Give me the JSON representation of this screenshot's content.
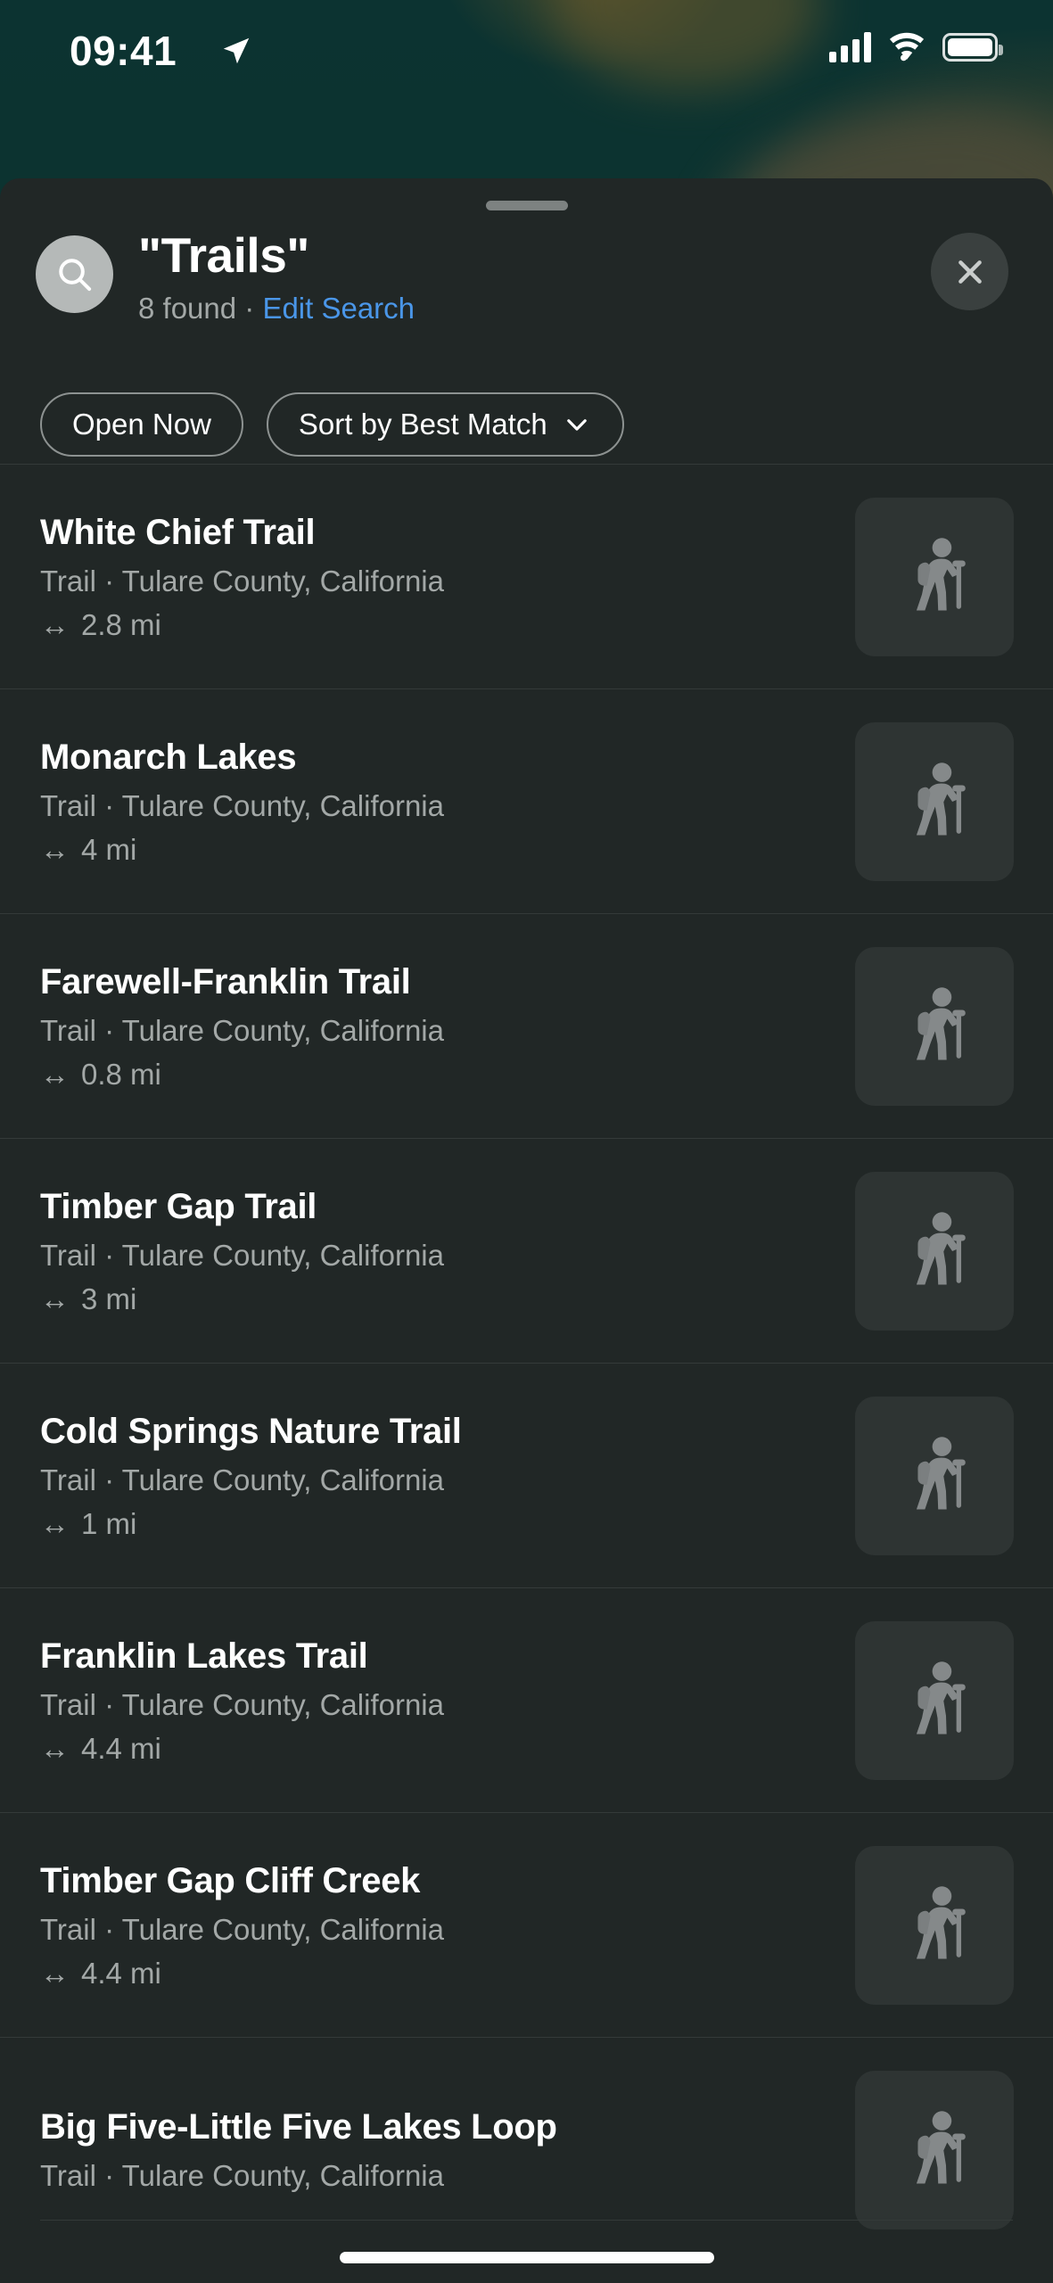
{
  "status_bar": {
    "time": "09:41",
    "location_icon": "location-arrow-icon",
    "cellular_icon": "cellular-signal-icon",
    "wifi_icon": "wifi-icon",
    "battery_icon": "battery-full-icon"
  },
  "map": {
    "background_color": "#0c3331",
    "terrain_color": "#4a4a38"
  },
  "sheet": {
    "search_icon": "search-icon",
    "title": "\"Trails\"",
    "found_count": "8 found",
    "separator": " · ",
    "edit_search": "Edit Search",
    "close_icon": "close-icon",
    "accent_color": "#4a96e8"
  },
  "filters": [
    {
      "label": "Open Now",
      "has_chevron": false
    },
    {
      "label": "Sort by Best Match",
      "has_chevron": true,
      "chevron_icon": "chevron-down-icon"
    }
  ],
  "results": [
    {
      "title": "White Chief Trail",
      "subtitle": "Trail · Tulare County, California",
      "distance": "2.8 mi",
      "thumb_icon": "hiker-icon"
    },
    {
      "title": "Monarch Lakes",
      "subtitle": "Trail · Tulare County, California",
      "distance": "4 mi",
      "thumb_icon": "hiker-icon"
    },
    {
      "title": "Farewell-Franklin Trail",
      "subtitle": "Trail · Tulare County, California",
      "distance": "0.8 mi",
      "thumb_icon": "hiker-icon"
    },
    {
      "title": "Timber Gap Trail",
      "subtitle": "Trail · Tulare County, California",
      "distance": "3 mi",
      "thumb_icon": "hiker-icon"
    },
    {
      "title": "Cold Springs Nature Trail",
      "subtitle": "Trail · Tulare County, California",
      "distance": "1 mi",
      "thumb_icon": "hiker-icon"
    },
    {
      "title": "Franklin Lakes Trail",
      "subtitle": "Trail · Tulare County, California",
      "distance": "4.4 mi",
      "thumb_icon": "hiker-icon"
    },
    {
      "title": "Timber Gap Cliff Creek",
      "subtitle": "Trail · Tulare County, California",
      "distance": "4.4 mi",
      "thumb_icon": "hiker-icon"
    },
    {
      "title": "Big Five-Little Five Lakes Loop",
      "subtitle": "Trail · Tulare County, California",
      "distance": "",
      "thumb_icon": "hiker-icon"
    }
  ],
  "distance_glyph": "↔"
}
